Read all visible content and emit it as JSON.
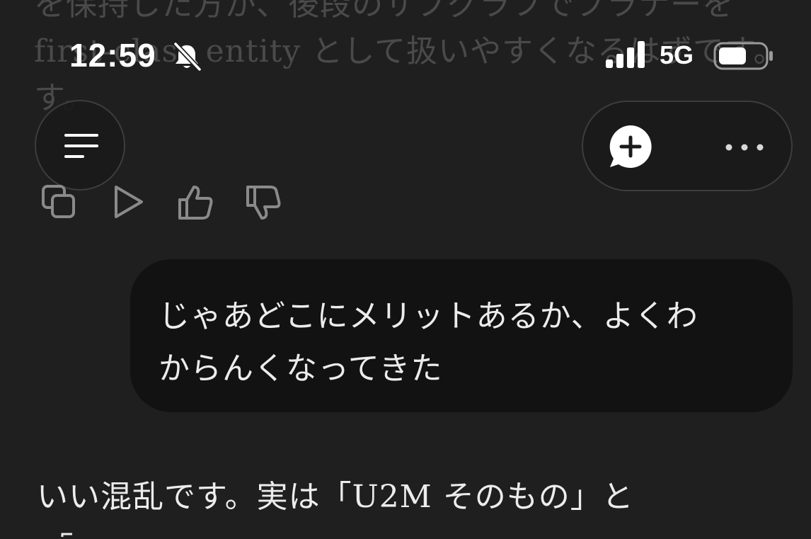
{
  "background_text": {
    "line1": "を保持した方が、後段のサブグラフでブラナーを",
    "line2": "first-class entity として扱いやすくなるはずです。",
    "line3": "す。"
  },
  "status_bar": {
    "time": "12:59",
    "network": "5G",
    "icons": [
      "bell-slash-icon",
      "signal-bars-icon",
      "battery-icon"
    ]
  },
  "header": {
    "menu_icon": "menu-icon",
    "new_chat_icon": "new-chat-icon",
    "more_icon": "more-icon"
  },
  "message_actions": {
    "icons": [
      "copy-icon",
      "play-icon",
      "thumbs-up-icon",
      "thumbs-down-icon"
    ]
  },
  "user_message": {
    "line1": "じゃあどこにメリットあるか、よくわ",
    "line2": "からんくなってきた"
  },
  "assistant_message": {
    "part1": "いい混乱です。実は「",
    "highlight": "U2M",
    "part2": " そのもの」と"
  },
  "colors": {
    "background": "#1f1f1f",
    "bubble": "#121212",
    "text": "#ececec",
    "icon": "#8a8a8a"
  }
}
